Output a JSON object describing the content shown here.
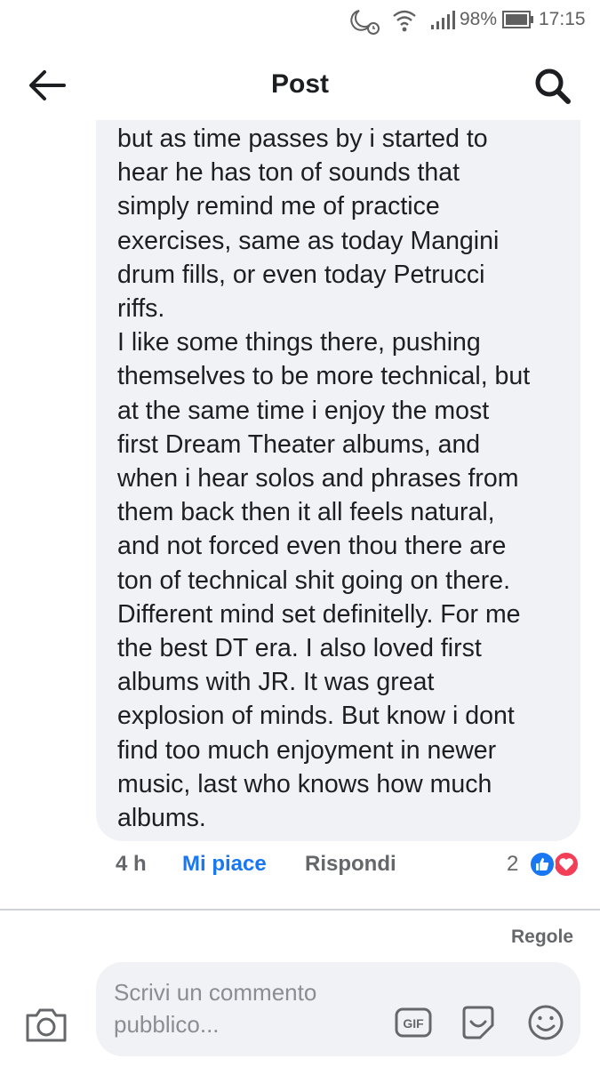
{
  "status_bar": {
    "battery": "98%",
    "time": "17:15"
  },
  "header": {
    "title": "Post"
  },
  "comment": {
    "text": "but as time passes by i started to\nhear he has ton of sounds that\nsimply remind me of practice\nexercises, same as today Mangini\ndrum fills, or even today Petrucci\nriffs.\nI like some things there, pushing\nthemselves to be more technical, but\nat the same time i enjoy the most\nfirst Dream Theater albums, and\nwhen i hear solos and phrases from\nthem back then it all feels natural,\nand not forced even thou there are\nton of technical shit going on there.\nDifferent mind set definitelly. For me\nthe best DT era. I also loved first\nalbums with JR. It was great\nexplosion of minds. But know i dont\nfind too much enjoyment in newer\nmusic, last who knows how much\nalbums.",
    "time": "4 h",
    "like_label": "Mi piace",
    "reply_label": "Rispondi",
    "reaction_count": "2"
  },
  "rules_label": "Regole",
  "composer": {
    "placeholder": "Scrivi un commento pubblico..."
  },
  "colors": {
    "accent": "#1877f2",
    "love": "#f33e58",
    "bubble": "#f0f2f5",
    "muted": "#65676b"
  },
  "icons": [
    "moon-alarm-icon",
    "wifi-icon",
    "signal-icon",
    "battery-icon",
    "back-arrow-icon",
    "search-icon",
    "like-reaction-icon",
    "love-reaction-icon",
    "camera-icon",
    "gif-icon",
    "sticker-icon",
    "emoji-icon"
  ]
}
